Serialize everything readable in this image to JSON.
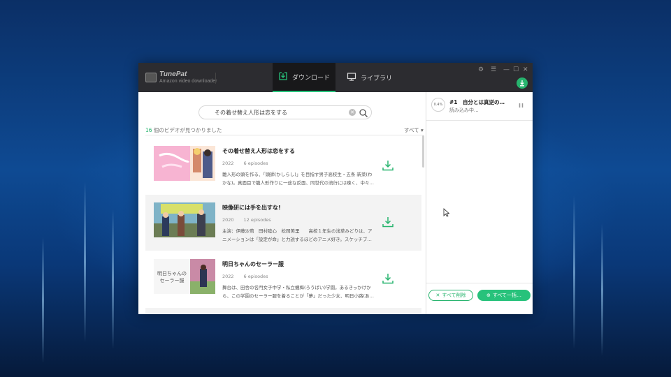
{
  "colors": {
    "accent": "#27c27b",
    "titlebar": "#2c2c30",
    "desktop": "#0e4a93"
  },
  "app": {
    "name": "TunePat",
    "subtitle": "Amazon video downloader"
  },
  "tabs": [
    {
      "label": "ダウンロード",
      "icon": "download-tray-icon",
      "active": true
    },
    {
      "label": "ライブラリ",
      "icon": "monitor-icon",
      "active": false
    }
  ],
  "window_controls": {
    "settings": "⚙",
    "menu": "☰",
    "minimize": "—",
    "maximize": "☐",
    "close": "✕"
  },
  "search": {
    "value": "その着せ替え人形は恋をする"
  },
  "results": {
    "count": "16",
    "count_suffix": " 個のビデオが見つかりました",
    "sort_label": "すべて ▾"
  },
  "videos": [
    {
      "title": "その着せ替え人形は恋をする",
      "year": "2022",
      "episodes": "6 episodes",
      "description": "雛人形の頭を作る、「頭師(かしらし)」を目指す男子高校生・五条 新菜(わかな)。真面目で雛人形作りに一途な反面、同世代の流行には疎く、中々…"
    },
    {
      "title": "映像研には手を出すな!",
      "year": "2020",
      "episodes": "12 episodes",
      "description": "主演：伊藤沙莉　田村睦心　松岡美里　　高校１年生の浅草みどりは、アニメーションは「設定が命」と力説するほどのアニメ好き。スケッチブ…"
    },
    {
      "title": "明日ちゃんのセーラー服",
      "year": "2022",
      "episodes": "6 episodes",
      "description": "舞台は、田舎の名門女子中学・私立蠟梅(ろうばい)学園。あるきっかけから、この学園のセーラー服を着ることが「夢」だった少女、明日小路(あ…",
      "thumb_text": "明日ちゃんの\nセーラー服"
    }
  ],
  "queue": {
    "task_title": "#1　自分とは真逆の…",
    "task_status": "読み込み中...",
    "progress": "0.4%",
    "progress_value": 0.004,
    "pause_label": "II",
    "clear_all_label": "すべて削除",
    "convert_all_label": "すべて一括…"
  }
}
